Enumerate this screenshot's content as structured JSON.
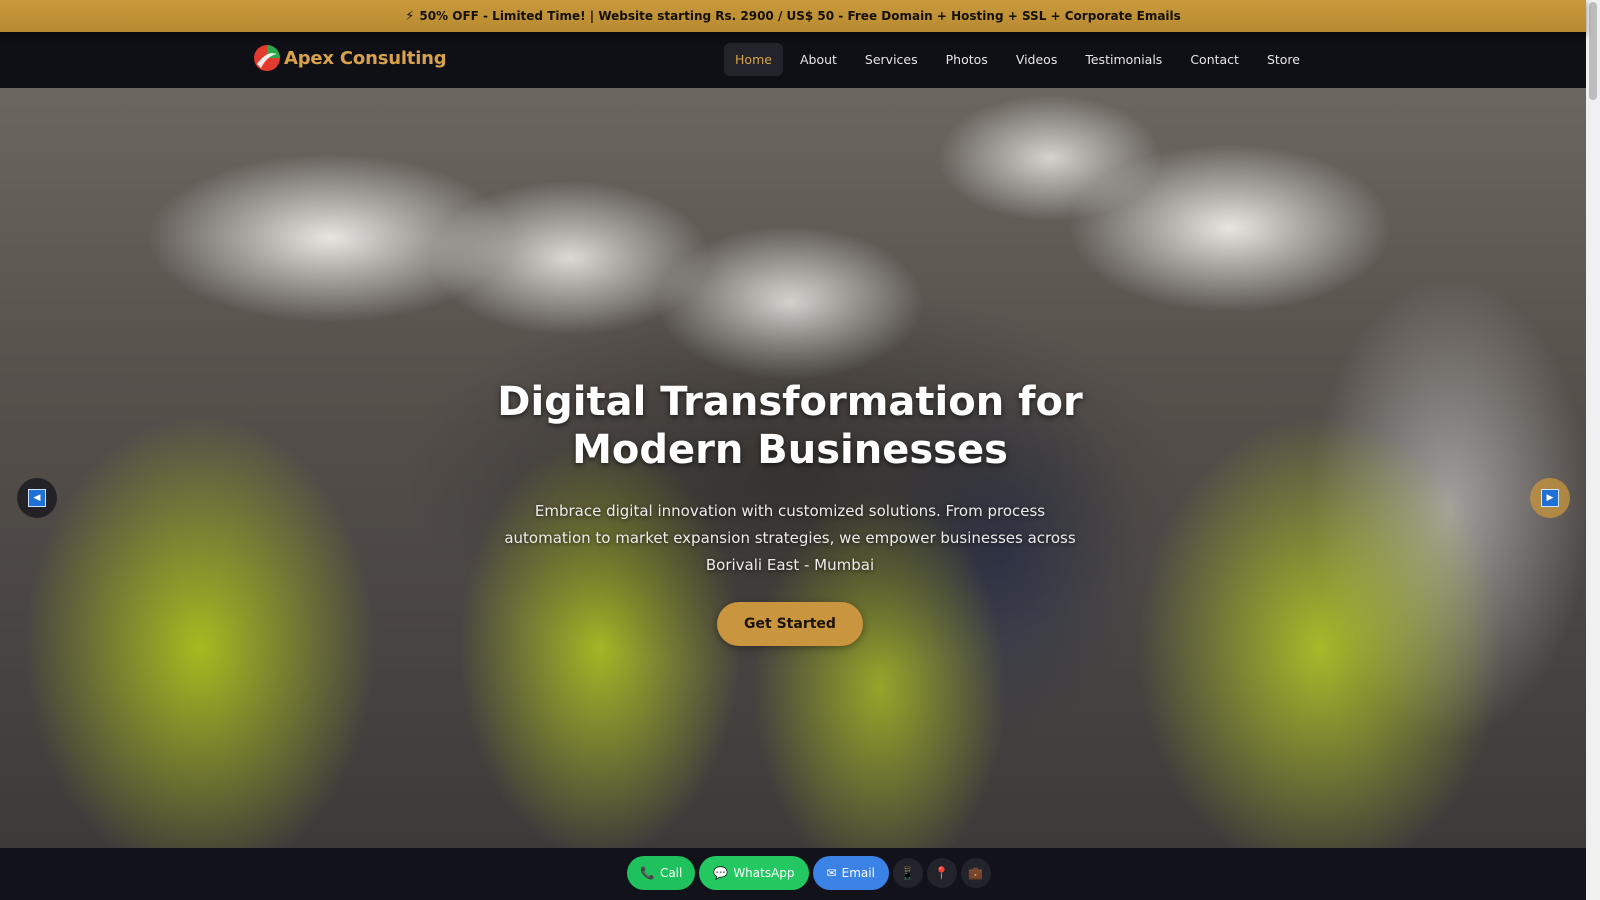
{
  "promo": {
    "icon": "bolt-icon",
    "text": "50% OFF - Limited Time! | Website starting Rs. 2900 / US$ 50 - Free Domain + Hosting + SSL + Corporate Emails"
  },
  "brand": {
    "name": "Apex Consulting",
    "color": "#d8a24a"
  },
  "nav": {
    "items": [
      {
        "label": "Home",
        "active": true
      },
      {
        "label": "About"
      },
      {
        "label": "Services"
      },
      {
        "label": "Photos"
      },
      {
        "label": "Videos"
      },
      {
        "label": "Testimonials"
      },
      {
        "label": "Contact"
      },
      {
        "label": "Store"
      }
    ]
  },
  "hero": {
    "title_line1": "Digital Transformation for",
    "title_line2": "Modern Businesses",
    "subtitle": "Embrace digital innovation with customized solutions. From process automation to market expansion strategies, we empower businesses across Borivali East - Mumbai",
    "cta_label": "Get Started",
    "cta_color": "#c9953f"
  },
  "contact_bar": {
    "call_label": "Call",
    "whatsapp_label": "WhatsApp",
    "email_label": "Email",
    "extra_icons": [
      "phone-device-icon",
      "location-pin-icon",
      "briefcase-icon"
    ]
  },
  "colors": {
    "accent": "#d8a24a",
    "call_green": "#1fc15c",
    "email_blue": "#3b82e6"
  }
}
